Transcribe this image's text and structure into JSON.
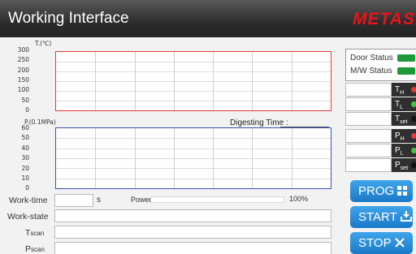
{
  "header": {
    "title": "Working Interface",
    "brand": "METASH"
  },
  "charts": {
    "temperature": {
      "axis_label": "T.(℃)",
      "ticks": [
        "300",
        "250",
        "200",
        "150",
        "100",
        "50",
        "0"
      ],
      "border_color": "#e53935"
    },
    "pressure": {
      "axis_label": "P.(0.1MPa)",
      "ticks": [
        "60",
        "50",
        "40",
        "30",
        "20",
        "10",
        "0"
      ],
      "border_color": "#3f51b5"
    }
  },
  "digesting_time_label": "Digesting Time :",
  "fields": {
    "work_time_label": "Work-time",
    "work_time_value": "",
    "work_time_unit": "s",
    "power_label": "Power",
    "power_value": 0,
    "power_max_label": "100%",
    "work_state_label": "Work-state",
    "work_state_value": "",
    "tscan_label_main": "T",
    "tscan_label_sub": "scan",
    "tscan_value": "",
    "pscan_label_main": "P",
    "pscan_label_sub": "scan",
    "pscan_value": ""
  },
  "status": {
    "door_label": "Door Status",
    "door_color": "#1e9a3a",
    "mw_label": "M/W Status",
    "mw_color": "#1e9a3a"
  },
  "temp_params": [
    {
      "main": "T",
      "sub": "H",
      "value": "",
      "dot_color": "#e53935"
    },
    {
      "main": "T",
      "sub": "L",
      "value": "",
      "dot_color": "#43c343"
    },
    {
      "main": "T",
      "sub": "set",
      "value": "",
      "dot_color": "#111111"
    }
  ],
  "press_params": [
    {
      "main": "P",
      "sub": "H",
      "value": "",
      "dot_color": "#e53935"
    },
    {
      "main": "P",
      "sub": "L",
      "value": "",
      "dot_color": "#43c343"
    },
    {
      "main": "P",
      "sub": "set",
      "value": "",
      "dot_color": "#111111"
    }
  ],
  "buttons": {
    "prog_label": "PROG",
    "prog_icon": "windows-grid-icon",
    "start_label": "START",
    "start_icon": "download-tray-icon",
    "stop_label": "STOP",
    "stop_icon": "close-x-icon"
  }
}
